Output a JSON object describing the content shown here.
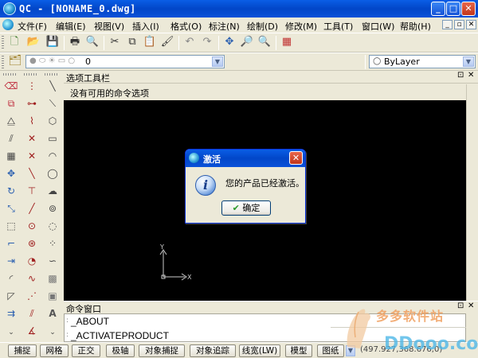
{
  "window": {
    "title": "QC - [NONAME_0.dwg]"
  },
  "menu": [
    "文件(F)",
    "编辑(E)",
    "视图(V)",
    "插入(I)",
    "格式(O)",
    "标注(N)",
    "绘制(D)",
    "修改(M)",
    "工具(T)",
    "窗口(W)",
    "帮助(H)"
  ],
  "layer": {
    "current": "0"
  },
  "bylayer": {
    "value": "ByLayer"
  },
  "options_panel": {
    "title": "选项工具栏",
    "message": "没有可用的命令选项"
  },
  "dialog": {
    "title": "激活",
    "message": "您的产品已经激活。",
    "ok_label": "确定"
  },
  "command_window": {
    "title": "命令窗口",
    "lines": [
      "_ABOUT",
      "_ACTIVATEPRODUCT"
    ]
  },
  "ucs": {
    "x_label": "X",
    "y_label": "Y"
  },
  "status": {
    "buttons": [
      "捕捉",
      "网格",
      "正交",
      "极轴",
      "对象捕捉",
      "对象追踪",
      "线宽(LW)",
      "模型",
      "图纸"
    ],
    "coords": "(497.927,368.676,0)"
  },
  "watermark": {
    "text1": "多多软件站",
    "text2": "DDooo.com"
  },
  "colors": {
    "titlebar": "#0a51d9",
    "canvas": "#000000",
    "chrome": "#ece9d8",
    "close": "#c1351a"
  }
}
